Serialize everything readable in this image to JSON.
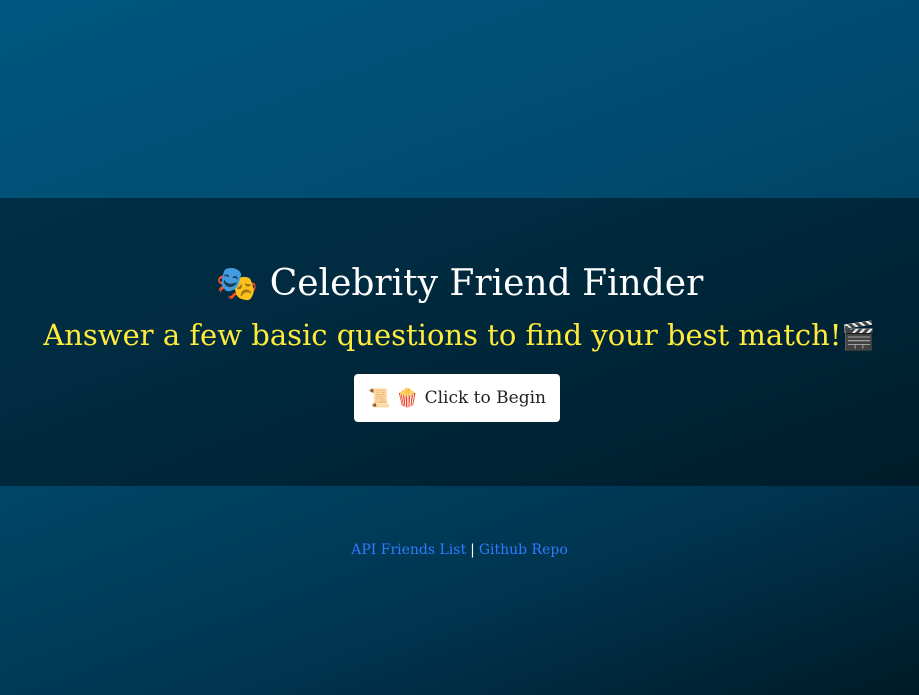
{
  "hero": {
    "title_icon": "🎭",
    "title": "Celebrity Friend Finder",
    "subtitle": "Answer a few basic questions to find your best match!",
    "subtitle_icon": "🎬",
    "begin_button": {
      "icons": "📜 🍿",
      "label": "Click to Begin"
    }
  },
  "footer": {
    "links": [
      {
        "label": "API Friends List"
      },
      {
        "label": "Github Repo"
      }
    ],
    "separator": "|"
  },
  "colors": {
    "background_top": "#00577f",
    "background_bottom": "#001a27",
    "title": "#ffffff",
    "subtitle": "#ffeb3b",
    "link": "#2f7bff",
    "button_bg": "#ffffff"
  },
  "icons": {
    "title_icon_name": "theater-masks-icon",
    "subtitle_icon_name": "clapper-board-icon",
    "button_icon_names": [
      "scroll-icon",
      "popcorn-icon"
    ]
  }
}
